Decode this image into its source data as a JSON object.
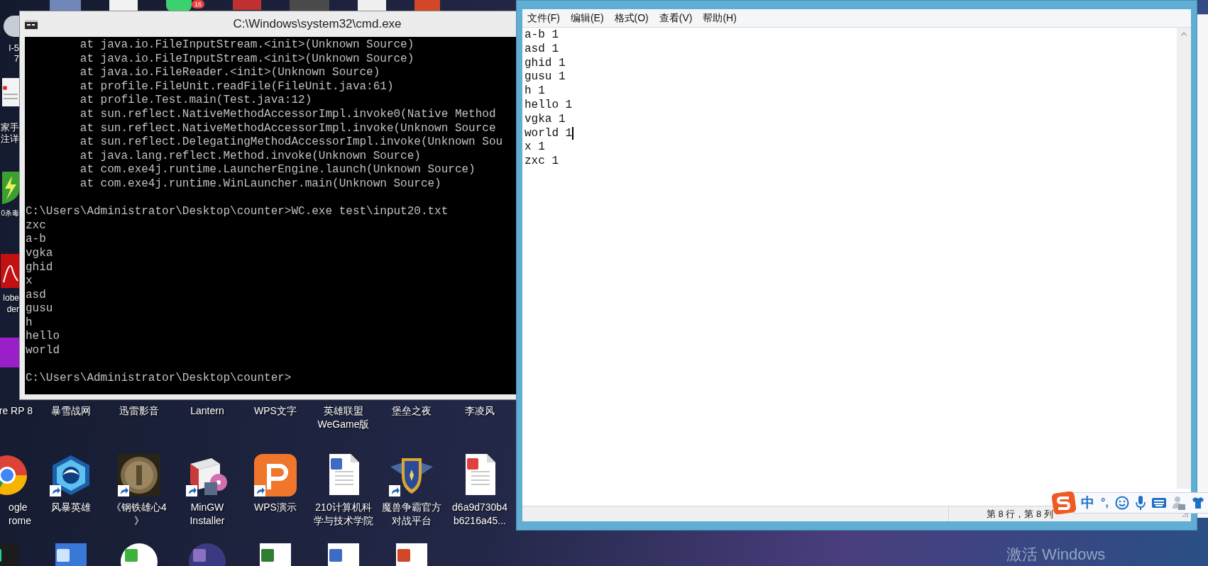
{
  "desktop": {
    "badge": "16",
    "side_icons": [
      {
        "label": "l-5\n7"
      },
      {
        "label": "家手注详"
      },
      {
        "label": "0杀毒"
      },
      {
        "label": "lobe\nder"
      }
    ],
    "rows": [
      [
        {
          "label": "re RP 8"
        },
        {
          "label": "暴雪战网"
        },
        {
          "label": "迅雷影音"
        },
        {
          "label": "Lantern"
        },
        {
          "label": "WPS文字"
        },
        {
          "label": "英雄联盟\nWeGame版"
        },
        {
          "label": "堡垒之夜"
        },
        {
          "label": "李凌风"
        }
      ],
      [
        {
          "label": "ogle\nrome",
          "shortcut": false
        },
        {
          "label": "风暴英雄",
          "shortcut": true
        },
        {
          "label": "《钢铁雄心4\n》",
          "shortcut": true
        },
        {
          "label": "MinGW\nInstaller",
          "shortcut": true
        },
        {
          "label": "WPS演示",
          "shortcut": true
        },
        {
          "label": "210计算机科学与技术学院",
          "shortcut": false
        },
        {
          "label": "魔兽争霸官方对战平台",
          "shortcut": true
        },
        {
          "label": "d6a9d730b4\nb6216a45...",
          "shortcut": false
        }
      ]
    ],
    "watermark": "激活 Windows"
  },
  "cmd": {
    "title": "C:\\Windows\\system32\\cmd.exe",
    "trace": [
      "        at java.io.FileInputStream.<init>(Unknown Source)",
      "        at java.io.FileInputStream.<init>(Unknown Source)",
      "        at java.io.FileReader.<init>(Unknown Source)",
      "        at profile.FileUnit.readFile(FileUnit.java:61)",
      "        at profile.Test.main(Test.java:12)",
      "        at sun.reflect.NativeMethodAccessorImpl.invoke0(Native Method",
      "        at sun.reflect.NativeMethodAccessorImpl.invoke(Unknown Source",
      "        at sun.reflect.DelegatingMethodAccessorImpl.invoke(Unknown Sou",
      "        at java.lang.reflect.Method.invoke(Unknown Source)",
      "        at com.exe4j.runtime.LauncherEngine.launch(Unknown Source)",
      "        at com.exe4j.runtime.WinLauncher.main(Unknown Source)"
    ],
    "command": "C:\\Users\\Administrator\\Desktop\\counter>WC.exe test\\input20.txt",
    "output": [
      "zxc",
      "a-b",
      "vgka",
      "ghid",
      "x",
      "asd",
      "gusu",
      "h",
      "hello",
      "world"
    ],
    "prompt": "C:\\Users\\Administrator\\Desktop\\counter>"
  },
  "notepad": {
    "menu": [
      "文件(F)",
      "编辑(E)",
      "格式(O)",
      "查看(V)",
      "帮助(H)"
    ],
    "lines": [
      {
        "text": "a-b 1",
        "caret": false
      },
      {
        "text": "asd 1",
        "caret": false
      },
      {
        "text": "ghid 1",
        "caret": false
      },
      {
        "text": "gusu 1",
        "caret": false
      },
      {
        "text": "h 1",
        "caret": false
      },
      {
        "text": "hello 1",
        "caret": false
      },
      {
        "text": "vgka 1",
        "caret": false
      },
      {
        "text": "world 1",
        "caret": true
      },
      {
        "text": "x 1",
        "caret": false
      },
      {
        "text": "zxc 1",
        "caret": false
      }
    ],
    "status": "第 8 行，第 8 列"
  },
  "ime": {
    "mode": "中",
    "punctuation": "°,"
  }
}
